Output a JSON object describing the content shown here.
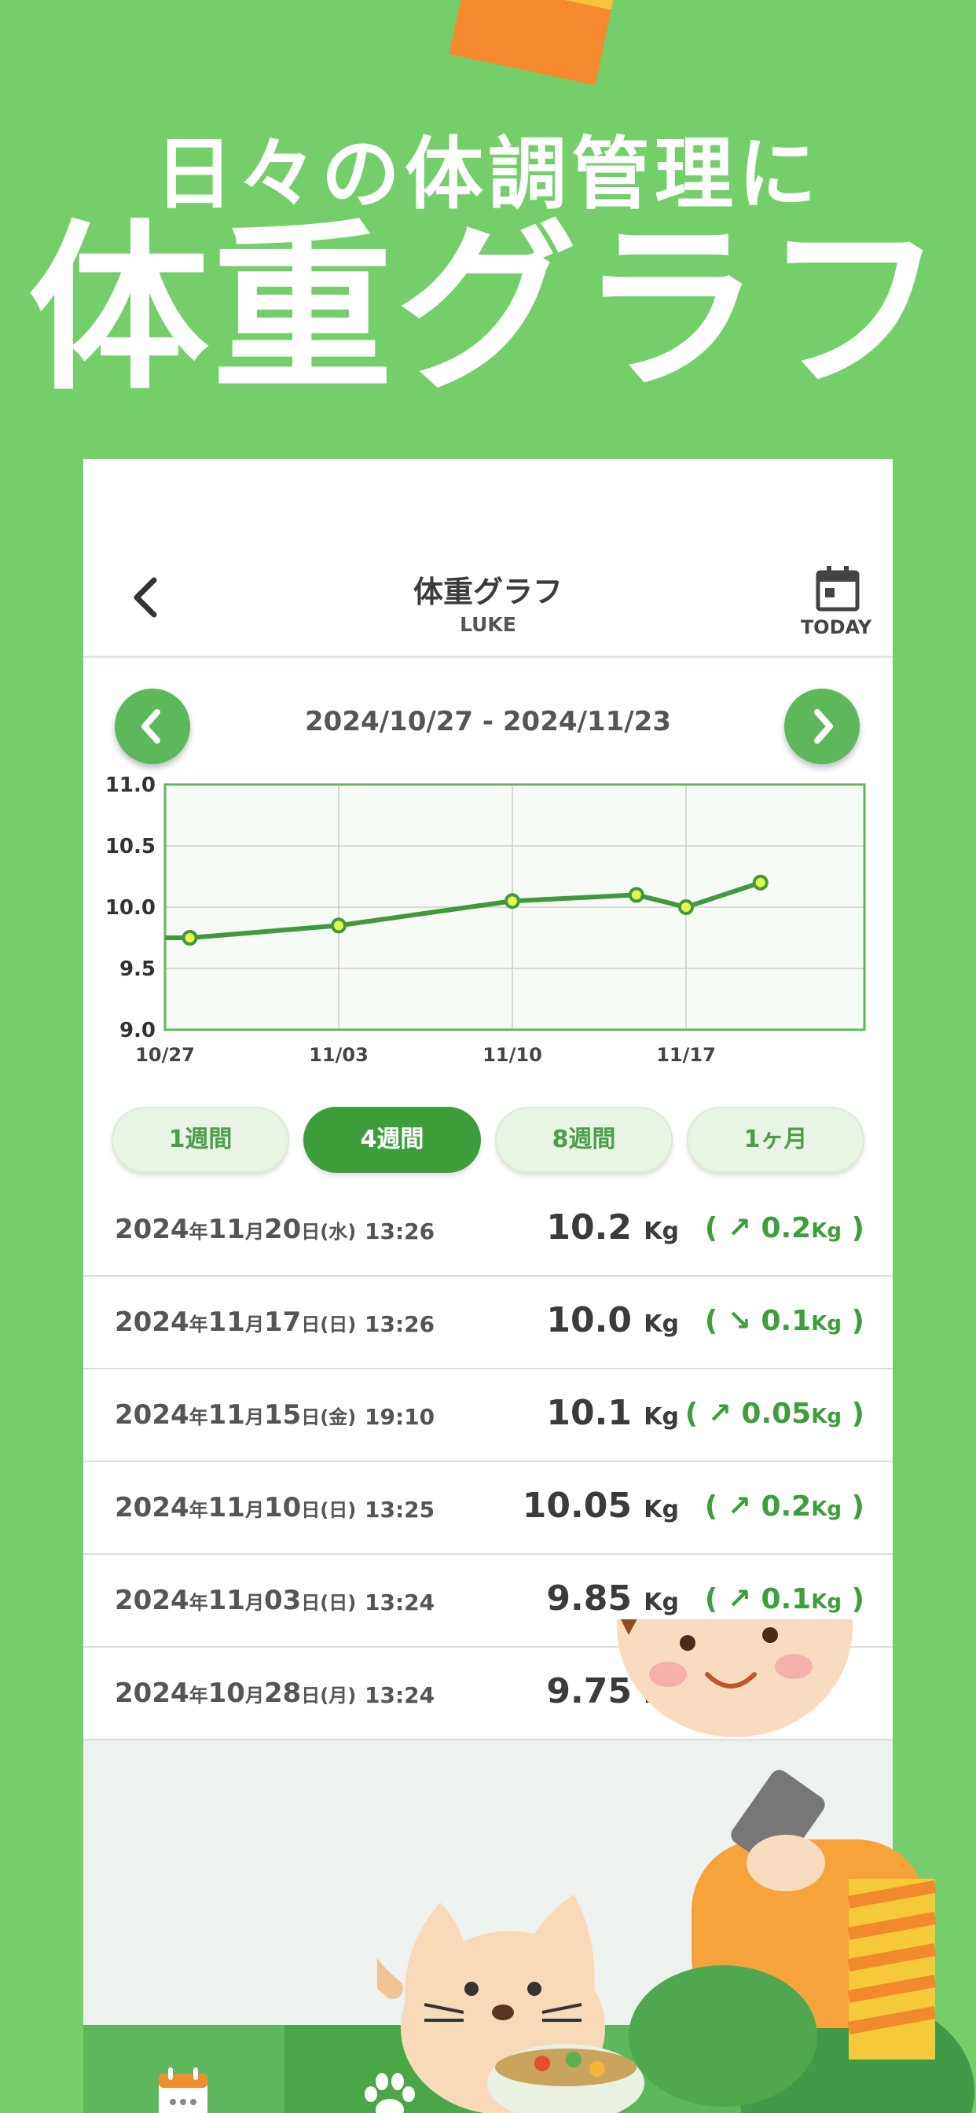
{
  "headline": {
    "line1": "日々の体調管理に",
    "line2": "体重グラフ"
  },
  "nav": {
    "title": "体重グラフ",
    "subtitle": "LUKE",
    "today_label": "TODAY",
    "back_icon": "chevron-left-icon",
    "today_icon": "calendar-icon"
  },
  "range": {
    "text": "2024/10/27 - 2024/11/23",
    "prev_icon": "chevron-left-icon",
    "next_icon": "chevron-right-icon"
  },
  "colors": {
    "background": "#74cf6b",
    "accent": "#3e9e3c",
    "line": "#3f9a3d",
    "point_fill": "#e7f54a"
  },
  "chart_data": {
    "type": "line",
    "x_tick_labels": [
      "10/27",
      "11/03",
      "11/10",
      "11/17"
    ],
    "x": [
      "10/27",
      "10/28",
      "11/03",
      "11/10",
      "11/15",
      "11/17",
      "11/20"
    ],
    "y": [
      9.75,
      9.75,
      9.85,
      10.05,
      10.1,
      10.0,
      10.2
    ],
    "markers": [
      false,
      true,
      true,
      true,
      true,
      true,
      true
    ],
    "ylim": [
      9.0,
      11.0
    ],
    "y_ticks": [
      "9.0",
      "9.5",
      "10.0",
      "10.5",
      "11.0"
    ],
    "grid": true
  },
  "periods": [
    {
      "label": "1週間",
      "active": false
    },
    {
      "label": "4週間",
      "active": true
    },
    {
      "label": "8週間",
      "active": false
    },
    {
      "label": "1ヶ月",
      "active": false
    }
  ],
  "records": [
    {
      "year": "2024",
      "month": "11",
      "day": "20",
      "dow": "(水)",
      "time": "13:26",
      "weight": "10.2",
      "unit": "Kg",
      "arrow": "↗",
      "diff": "0.2"
    },
    {
      "year": "2024",
      "month": "11",
      "day": "17",
      "dow": "(日)",
      "time": "13:26",
      "weight": "10.0",
      "unit": "Kg",
      "arrow": "↘",
      "diff": "0.1"
    },
    {
      "year": "2024",
      "month": "11",
      "day": "15",
      "dow": "(金)",
      "time": "19:10",
      "weight": "10.1",
      "unit": "Kg",
      "arrow": "↗",
      "diff": "0.05"
    },
    {
      "year": "2024",
      "month": "11",
      "day": "10",
      "dow": "(日)",
      "time": "13:25",
      "weight": "10.05",
      "unit": "Kg",
      "arrow": "↗",
      "diff": "0.2"
    },
    {
      "year": "2024",
      "month": "11",
      "day": "03",
      "dow": "(日)",
      "time": "13:24",
      "weight": "9.85",
      "unit": "Kg",
      "arrow": "↗",
      "diff": "0.1"
    },
    {
      "year": "2024",
      "month": "10",
      "day": "28",
      "dow": "(月)",
      "time": "13:24",
      "weight": "9.75",
      "unit": "Kg",
      "arrow": "",
      "diff": ""
    }
  ],
  "date_units": {
    "year": "年",
    "month": "月",
    "day": "日"
  },
  "tabbar": {
    "tabs": [
      {
        "icon": "calendar-icon"
      },
      {
        "icon": "paw-icon"
      }
    ]
  }
}
